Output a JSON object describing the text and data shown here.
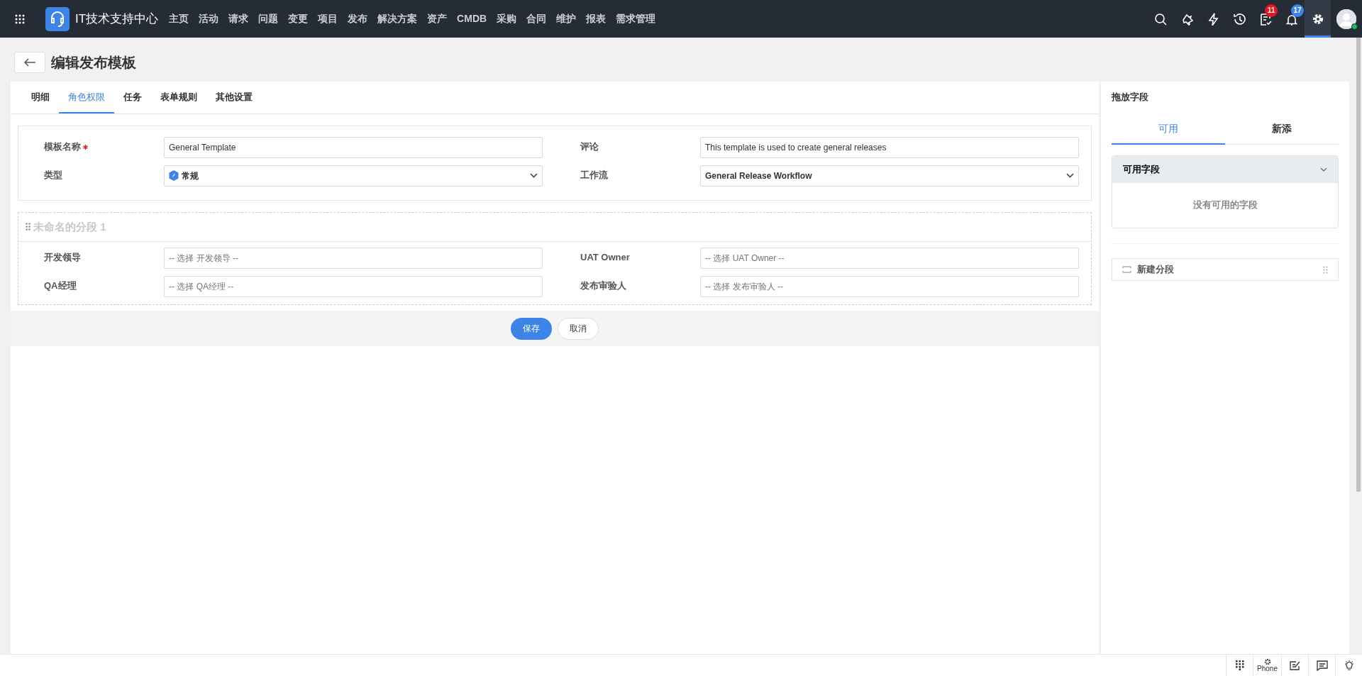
{
  "app": {
    "title": "IT技术支持中心"
  },
  "nav": [
    "主页",
    "活动",
    "请求",
    "问题",
    "变更",
    "项目",
    "发布",
    "解决方案",
    "资产",
    "CMDB",
    "采购",
    "合同",
    "维护",
    "报表",
    "需求管理"
  ],
  "header_icons": [
    {
      "kind": "search"
    },
    {
      "kind": "wand"
    },
    {
      "kind": "bolt"
    },
    {
      "kind": "history"
    },
    {
      "kind": "tasks",
      "badge": "11",
      "color": "#e8141e"
    },
    {
      "kind": "bell",
      "badge": "17",
      "color": "#3d84e8"
    },
    {
      "kind": "gear",
      "selected": true
    }
  ],
  "page": {
    "title": "编辑发布模板"
  },
  "tabs": [
    {
      "label": "明细",
      "selected": false
    },
    {
      "label": "角色权限",
      "selected": true
    },
    {
      "label": "任务",
      "selected": false
    },
    {
      "label": "表单规则",
      "selected": false
    },
    {
      "label": "其他设置",
      "selected": false
    }
  ],
  "fields": [
    {
      "label": "模板名称",
      "required": true,
      "kind": "text",
      "value": "General Template"
    },
    {
      "label": "评论",
      "required": false,
      "kind": "text",
      "value": "This template is used to create general releases"
    },
    {
      "label": "类型",
      "required": false,
      "kind": "type-select",
      "value": "常规"
    },
    {
      "label": "工作流",
      "required": false,
      "kind": "select",
      "value": "General Release Workflow"
    }
  ],
  "section": {
    "title": "未命名的分段 1",
    "fields": [
      {
        "label": "开发领导",
        "placeholder": "-- 选择 开发领导 --"
      },
      {
        "label": "UAT Owner",
        "placeholder": "-- 选择 UAT Owner --"
      },
      {
        "label": "QA经理",
        "placeholder": "-- 选择 QA经理 --"
      },
      {
        "label": "发布审验人",
        "placeholder": "-- 选择 发布审验人 --"
      }
    ]
  },
  "buttons": [
    {
      "label": "保存",
      "kind": "primary"
    },
    {
      "label": "取消",
      "kind": "secondary"
    }
  ],
  "side": {
    "title": "拖放字段",
    "tabs": [
      {
        "label": "可用",
        "selected": true
      },
      {
        "label": "新添",
        "selected": false
      }
    ],
    "group": {
      "title": "可用字段",
      "expanded": true,
      "empty_text": "没有可用的字段"
    },
    "new_section": "新建分段"
  },
  "bottom_bar": {
    "phone_label": "Phone"
  }
}
